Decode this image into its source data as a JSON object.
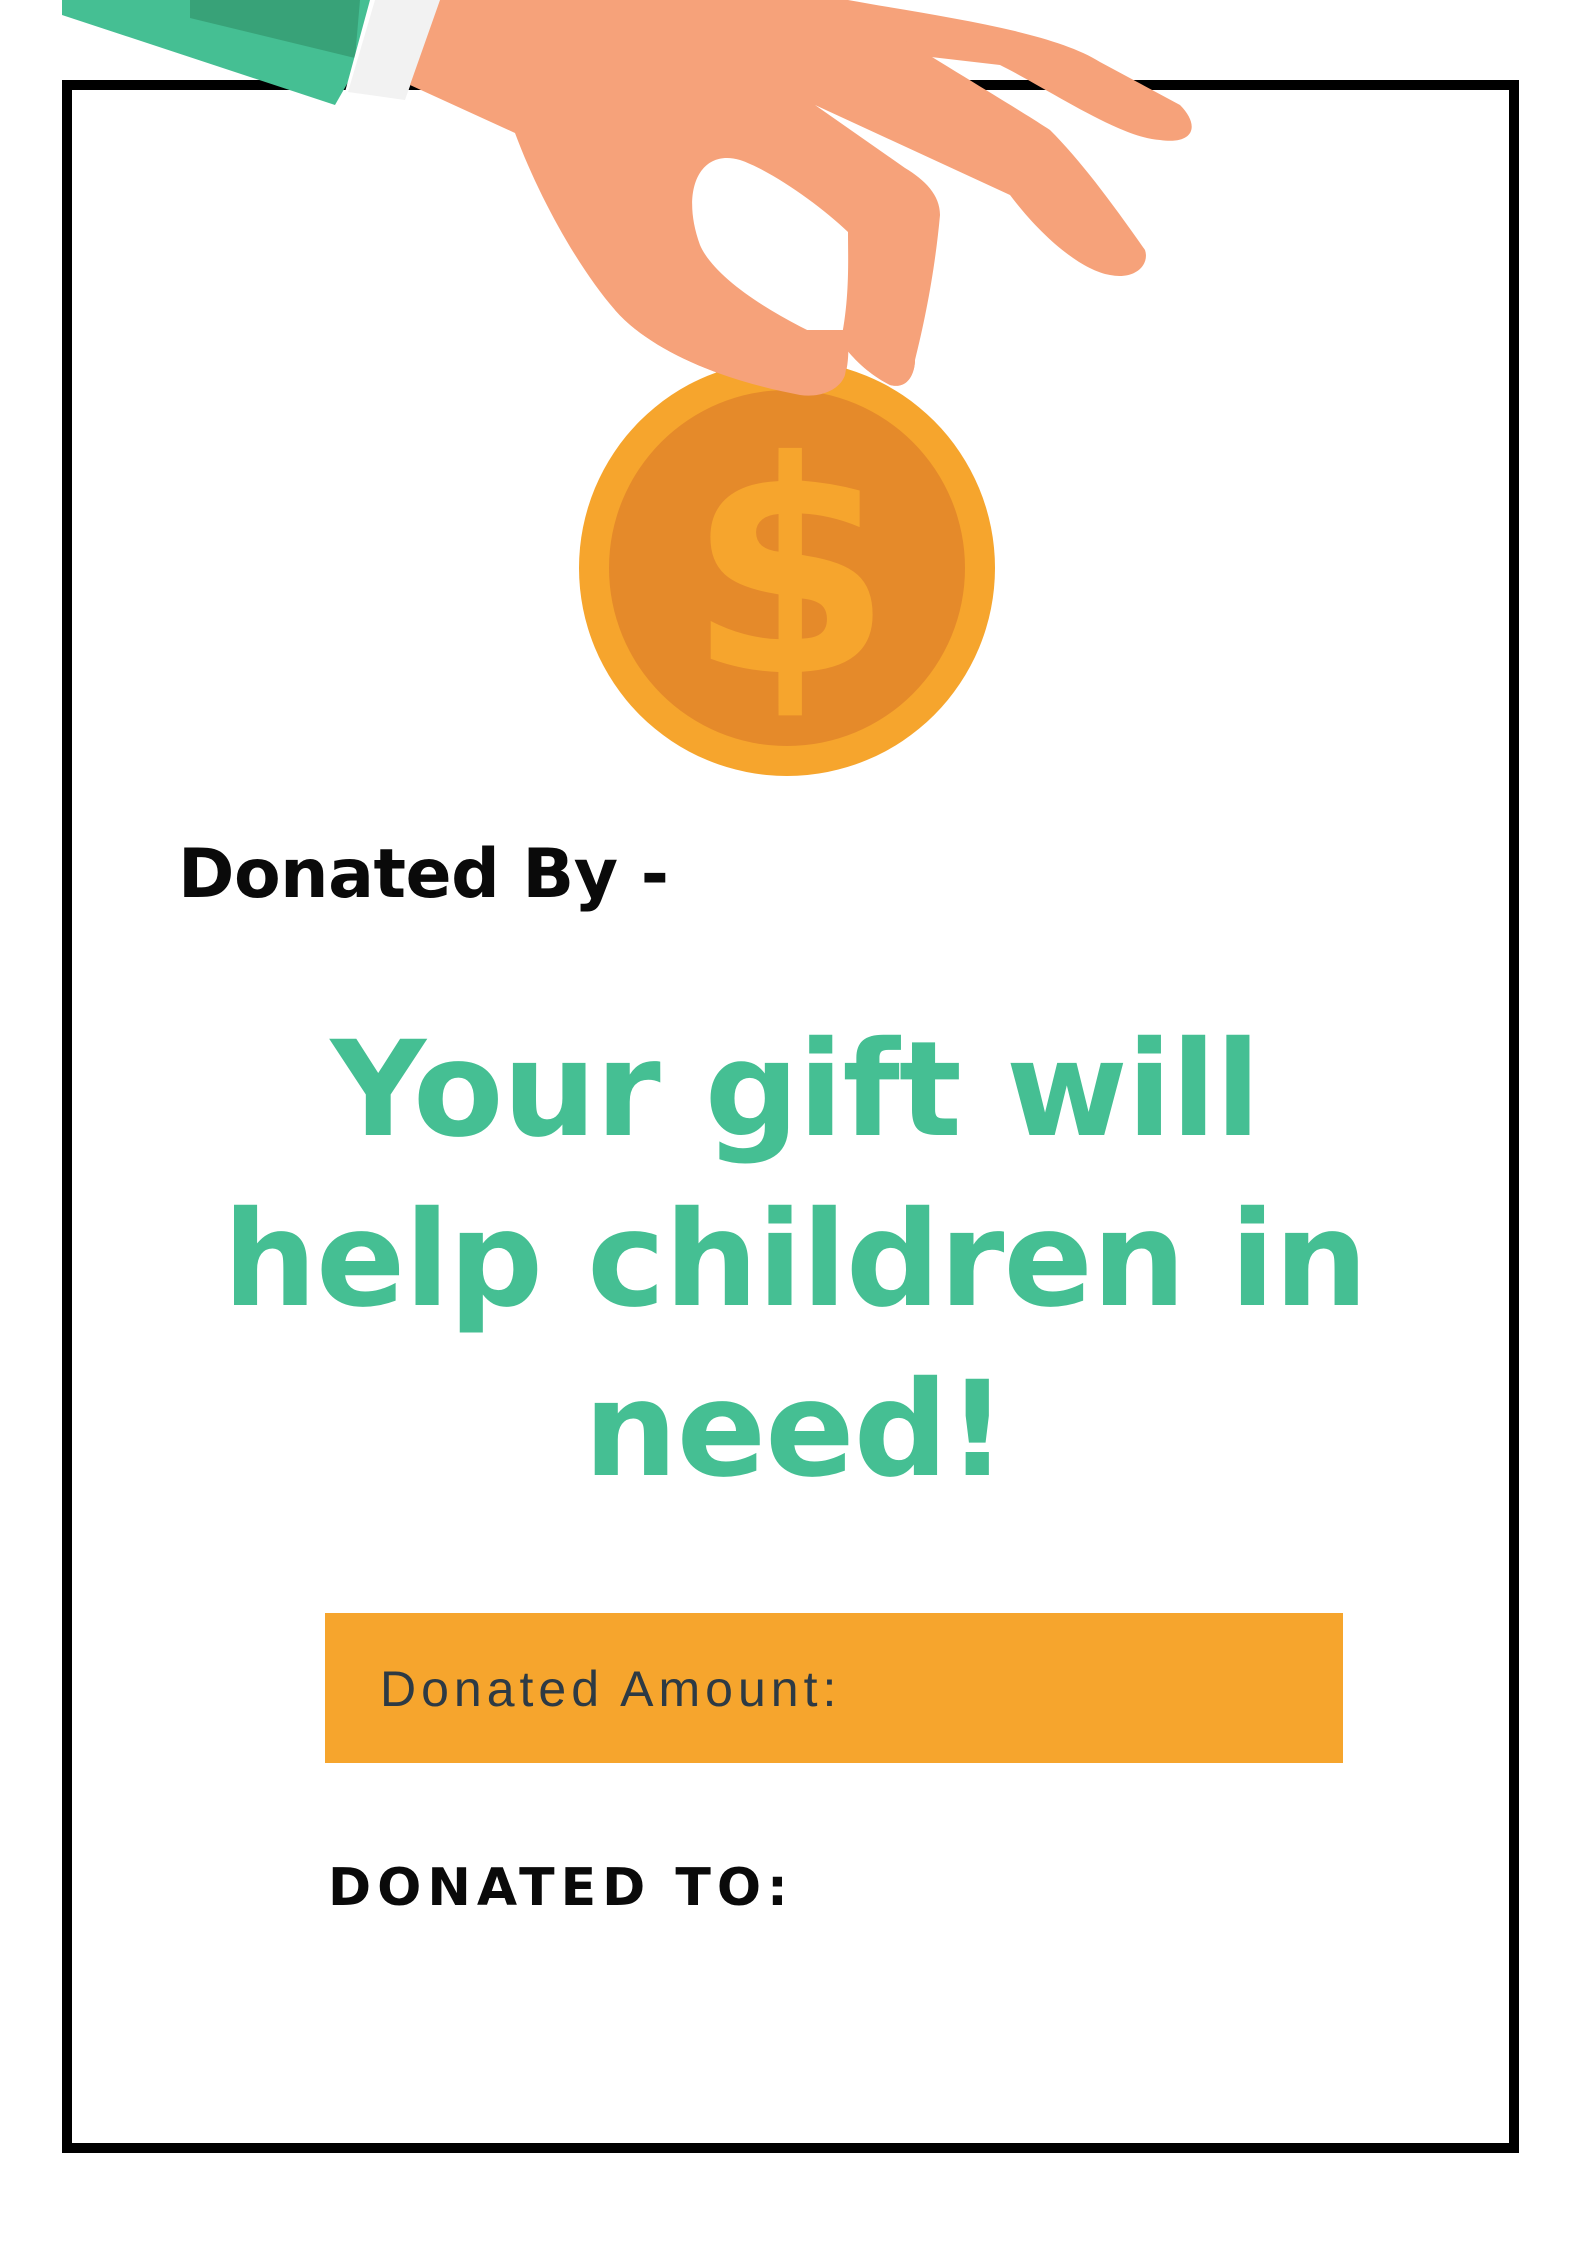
{
  "certificate": {
    "donated_by_label": "Donated By -",
    "headline_lines": [
      "Your gift will",
      "help children in",
      "need!"
    ],
    "amount_label": "Donated Amount:",
    "donated_to_label": "DONATED TO:"
  },
  "illustration": {
    "icon": "hand-dropping-coin-icon",
    "coin_symbol": "$"
  },
  "colors": {
    "headline_green": "#45bf93",
    "amount_bar": "#f6a52d",
    "coin_outer": "#f6a52d",
    "coin_inner": "#e58a2a",
    "skin": "#f6a27a",
    "sleeve": "#45bf93",
    "frame": "#000000"
  }
}
